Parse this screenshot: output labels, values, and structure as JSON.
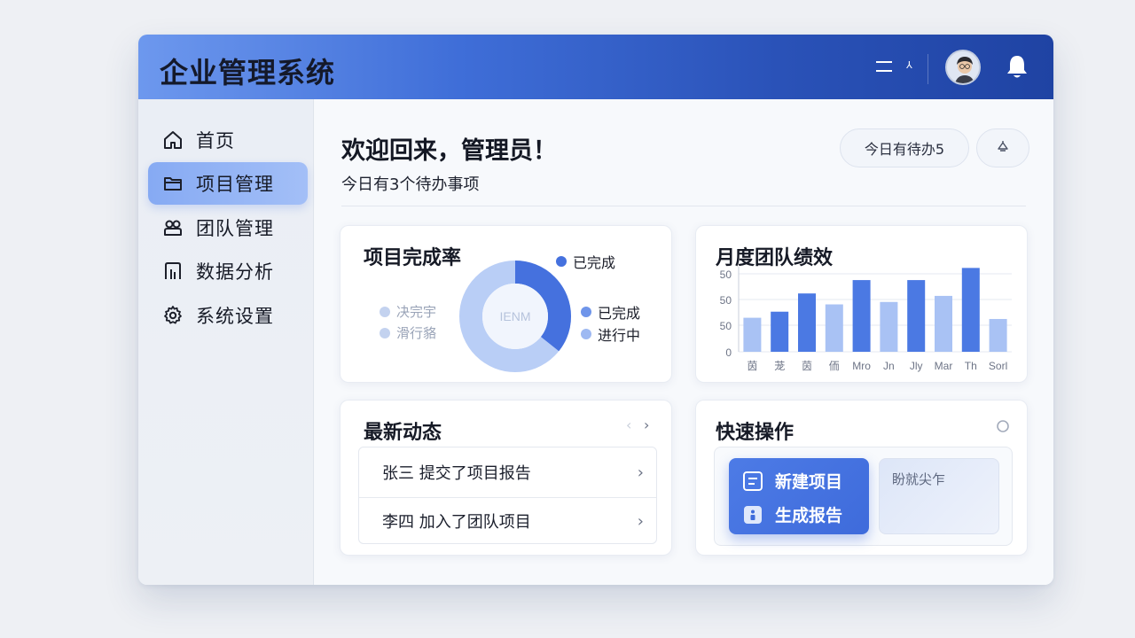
{
  "app": {
    "title": "企业管理系统"
  },
  "sidebar": {
    "items": [
      {
        "label": "首页",
        "icon": "home-icon",
        "active": false
      },
      {
        "label": "项目管理",
        "icon": "folder-icon",
        "active": true
      },
      {
        "label": "团队管理",
        "icon": "team-icon",
        "active": false
      },
      {
        "label": "数据分析",
        "icon": "analytics-icon",
        "active": false
      },
      {
        "label": "系统设置",
        "icon": "gear-icon",
        "active": false
      }
    ]
  },
  "main": {
    "welcome": "欢迎回来，管理员！",
    "subtitle": "今日有3个待办事项",
    "pill_todo": "今日有待办5"
  },
  "completion_card": {
    "title": "项目完成率",
    "center_label": "IENM",
    "legend_right": [
      "已完成",
      "已完成",
      "进行中"
    ],
    "legend_left": [
      "决完宇",
      "滑行貉"
    ]
  },
  "chart_data": {
    "type": "bar",
    "title": "月度团队绩效",
    "categories": [
      "茵",
      "茏",
      "茵",
      "侕",
      "Mro",
      "Jn",
      "Jly",
      "Mar",
      "Th",
      "Sorl"
    ],
    "series": [
      {
        "values": [
          28,
          33,
          48,
          39,
          59,
          41,
          59,
          46,
          69,
          27
        ],
        "color": "#a9c2f4"
      }
    ],
    "bar_colors": [
      "#a9c2f4",
      "#4b79e3",
      "#4b79e3",
      "#a9c2f4",
      "#4b79e3",
      "#a9c2f4",
      "#4b79e3",
      "#a9c2f4",
      "#4b79e3",
      "#a9c2f4"
    ],
    "y_ticks": [
      "50",
      "50",
      "50",
      "0"
    ],
    "ylim": [
      0,
      70
    ],
    "grid": true
  },
  "feed_card": {
    "title": "最新动态",
    "items": [
      "张三  提交了项目报告",
      "李四  加入了团队项目"
    ]
  },
  "quick_card": {
    "title": "快速操作",
    "actions": [
      "新建项目",
      "生成报告"
    ],
    "secondary_text": "盼就尖乍"
  },
  "colors": {
    "accent": "#4b79e3",
    "accent_light": "#a9c2f4",
    "header_dark": "#1f43a3"
  }
}
